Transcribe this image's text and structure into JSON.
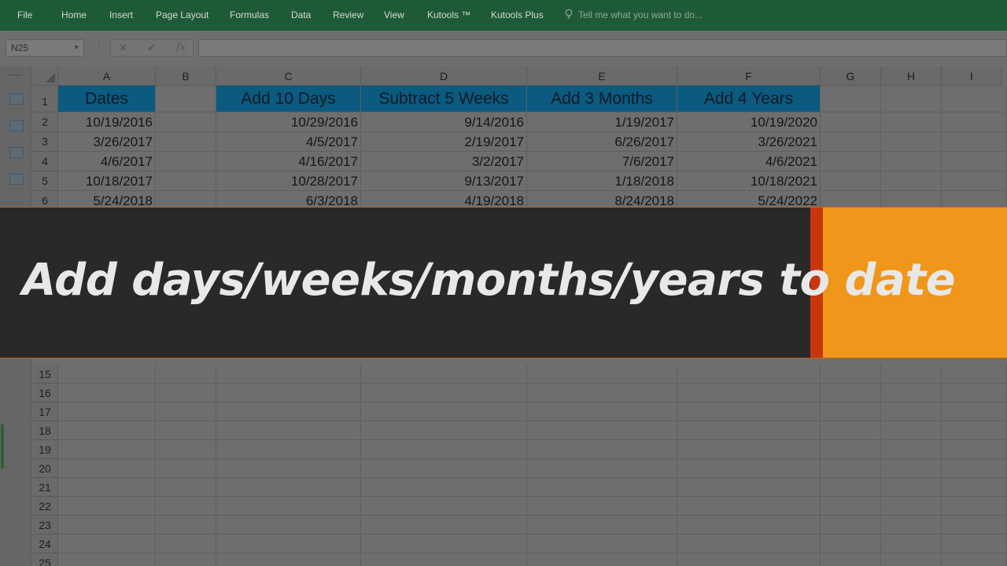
{
  "ribbon": {
    "tabs": [
      "File",
      "Home",
      "Insert",
      "Page Layout",
      "Formulas",
      "Data",
      "Review",
      "View",
      "Kutools ™",
      "Kutools Plus"
    ],
    "tell_me": "Tell me what you want to do..."
  },
  "formula_bar": {
    "name_box": "N25",
    "cancel_icon": "✕",
    "enter_icon": "✔",
    "fx_label": "fx",
    "separator": "⋮",
    "formula": ""
  },
  "columns": [
    "A",
    "B",
    "C",
    "D",
    "E",
    "F",
    "G",
    "H",
    "I"
  ],
  "header_row": {
    "row_number": "1",
    "A": "Dates",
    "B": "",
    "C": "Add 10 Days",
    "D": "Subtract 5 Weeks",
    "E": "Add 3 Months",
    "F": "Add 4 Years"
  },
  "data_rows": [
    {
      "n": "2",
      "A": "10/19/2016",
      "C": "10/29/2016",
      "D": "9/14/2016",
      "E": "1/19/2017",
      "F": "10/19/2020"
    },
    {
      "n": "3",
      "A": "3/26/2017",
      "C": "4/5/2017",
      "D": "2/19/2017",
      "E": "6/26/2017",
      "F": "3/26/2021"
    },
    {
      "n": "4",
      "A": "4/6/2017",
      "C": "4/16/2017",
      "D": "3/2/2017",
      "E": "7/6/2017",
      "F": "4/6/2021"
    },
    {
      "n": "5",
      "A": "10/18/2017",
      "C": "10/28/2017",
      "D": "9/13/2017",
      "E": "1/18/2018",
      "F": "10/18/2021"
    },
    {
      "n": "6",
      "A": "5/24/2018",
      "C": "6/3/2018",
      "D": "4/19/2018",
      "E": "8/24/2018",
      "F": "5/24/2022"
    }
  ],
  "lower_rows": [
    "15",
    "16",
    "17",
    "18",
    "19",
    "20",
    "21",
    "22",
    "23",
    "24",
    "25"
  ],
  "banner": {
    "text_main": "Add days/weeks/months/years to ",
    "text_accent": "date"
  },
  "colors": {
    "ribbon": "#1f5a37",
    "header_fill": "#0b5a80",
    "banner_bg": "#292929",
    "banner_orange": "#f0961a",
    "banner_stripe": "#c8360e"
  }
}
